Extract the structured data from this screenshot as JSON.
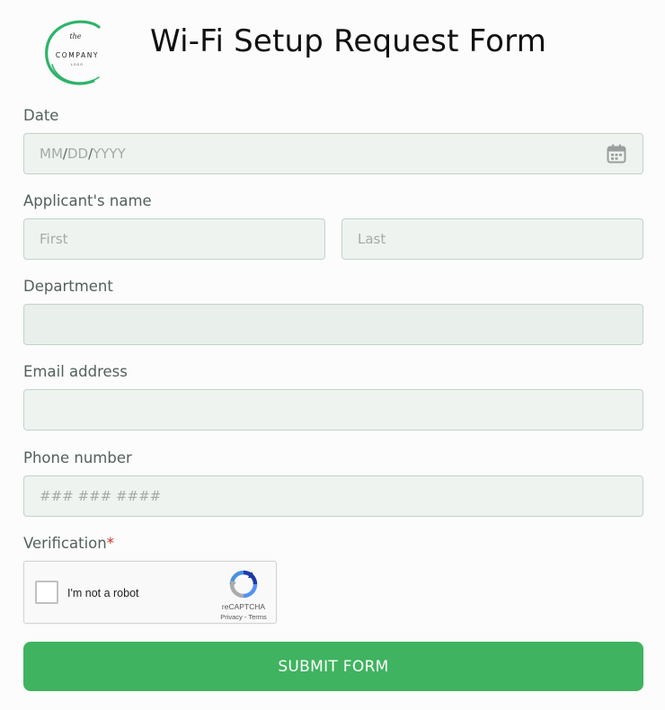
{
  "logo": {
    "top_text": "the",
    "company_text": "COMPANY",
    "bottom_text": "LOGO",
    "accent_color": "#2fb36a"
  },
  "form": {
    "title": "Wi-Fi Setup Request Form",
    "date": {
      "label": "Date",
      "placeholder_mm": "MM",
      "placeholder_dd": "DD",
      "placeholder_yyyy": "YYYY",
      "separator": "/",
      "icon": "calendar-icon"
    },
    "name": {
      "label": "Applicant's name",
      "first_placeholder": "First",
      "last_placeholder": "Last"
    },
    "department": {
      "label": "Department",
      "value": ""
    },
    "email": {
      "label": "Email address",
      "value": ""
    },
    "phone": {
      "label": "Phone number",
      "placeholder": "### ### ####"
    },
    "verification": {
      "label": "Verification",
      "required_mark": "*",
      "checkbox_label": "I'm not a robot",
      "brand": "reCAPTCHA",
      "terms": "Privacy - Terms"
    },
    "submit_label": "SUBMIT FORM"
  },
  "colors": {
    "field_bg": "#eef3f0",
    "field_border": "#c2d3c9",
    "submit_bg": "#3fb35f",
    "required": "#d0312d"
  }
}
